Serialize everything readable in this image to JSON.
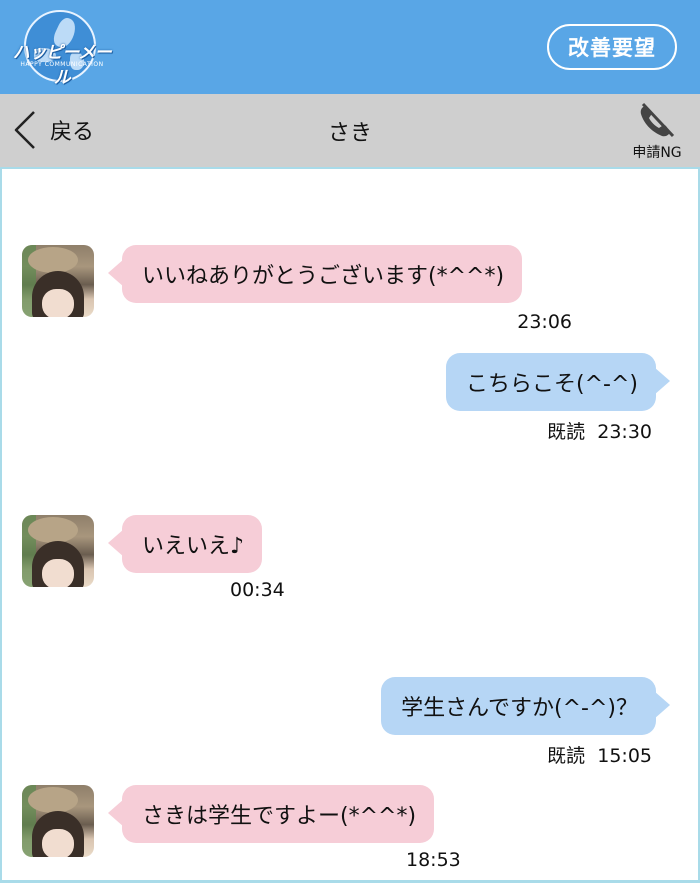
{
  "header": {
    "logo_text": "ハッピーメール",
    "logo_sub": "HAPPY COMMUNICATION",
    "improve_label": "改善要望"
  },
  "nav": {
    "back_label": "戻る",
    "title": "さき",
    "ng_label": "申請NG"
  },
  "messages": [
    {
      "side": "in",
      "text": "いいねありがとうございます(*^^*)",
      "time": "23:06"
    },
    {
      "side": "out",
      "text": "こちらこそ(^-^)",
      "read": "既読",
      "time": "23:30"
    },
    {
      "side": "in",
      "text": "いえいえ♪",
      "time": "00:34"
    },
    {
      "side": "out",
      "text": "学生さんですか(^-^)？",
      "read": "既読",
      "time": "15:05"
    },
    {
      "side": "in",
      "text": "さきは学生ですよー(*^^*)",
      "time": "18:53"
    }
  ],
  "colors": {
    "header_blue": "#59a6e6",
    "nav_gray": "#cfcfcf",
    "incoming_bubble": "#f6cdd7",
    "outgoing_bubble": "#b6d6f5",
    "chat_border": "#a9dbe9"
  }
}
